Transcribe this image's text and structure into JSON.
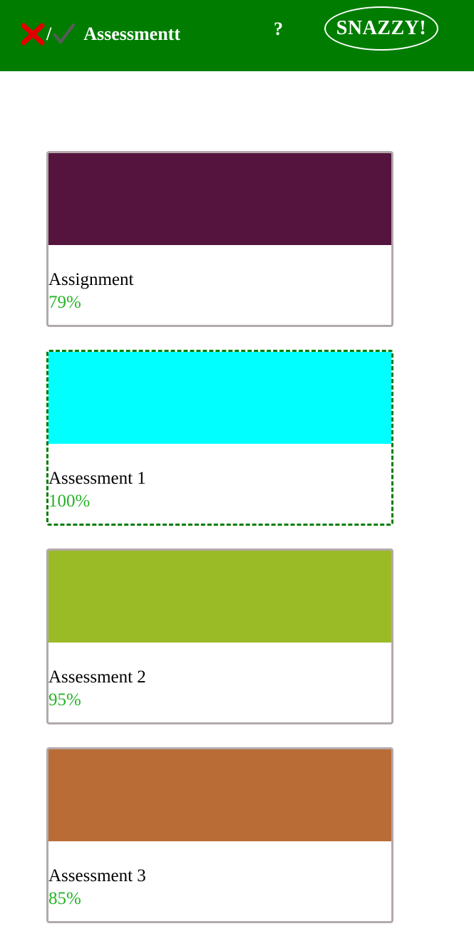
{
  "header": {
    "title": "Assessmentt",
    "separator": "/",
    "help_label": "?",
    "snazzy_label": "SNAZZY!",
    "colors": {
      "background": "#007d00",
      "cross": "#e00000",
      "check": "#5a5a5a"
    },
    "icons": [
      "cross-icon",
      "check-icon"
    ]
  },
  "cards": [
    {
      "title": "Assignment",
      "score": "79%",
      "color": "#55143e",
      "selected": false
    },
    {
      "title": "Assessment 1",
      "score": "100%",
      "color": "#00ffff",
      "selected": true
    },
    {
      "title": "Assessment 2",
      "score": "95%",
      "color": "#9bbb26",
      "selected": false
    },
    {
      "title": "Assessment 3",
      "score": "85%",
      "color": "#ba6c36",
      "selected": false
    }
  ],
  "score_color": "#25b325"
}
